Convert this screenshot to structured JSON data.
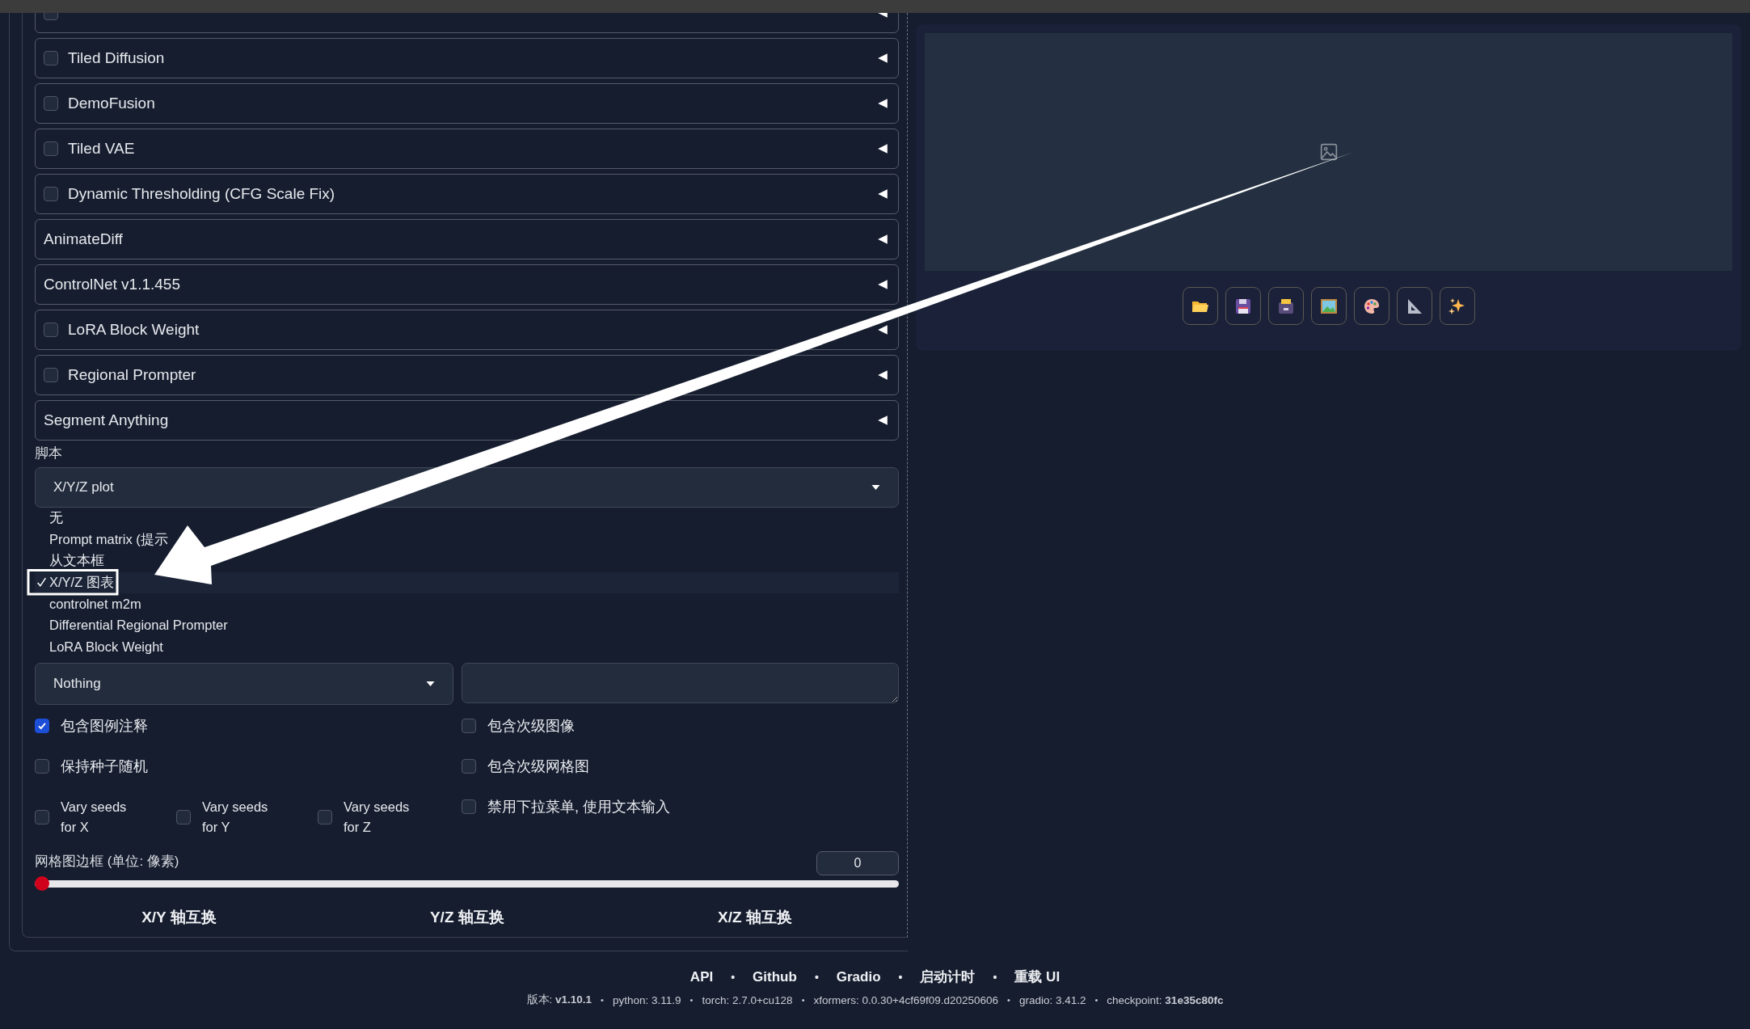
{
  "accordions": [
    {
      "kind": "checkbox",
      "checked": false
    },
    {
      "label": "Tiled Diffusion",
      "kind": "checkbox",
      "checked": false
    },
    {
      "label": "DemoFusion",
      "kind": "checkbox",
      "checked": false
    },
    {
      "label": "Tiled VAE",
      "kind": "checkbox",
      "checked": false
    },
    {
      "label": "Dynamic Thresholding (CFG Scale Fix)",
      "kind": "checkbox",
      "checked": false
    },
    {
      "label": "AnimateDiff",
      "kind": "plain"
    },
    {
      "label": "ControlNet v1.1.455",
      "kind": "plain"
    },
    {
      "label": "LoRA Block Weight",
      "kind": "checkbox",
      "checked": false
    },
    {
      "label": "Regional Prompter",
      "kind": "checkbox",
      "checked": false
    },
    {
      "label": "Segment Anything",
      "kind": "plain"
    }
  ],
  "script": {
    "label": "脚本",
    "value": "X/Y/Z plot",
    "options": [
      {
        "label": "无",
        "selected": false
      },
      {
        "label": "Prompt matrix (提示",
        "selected": false
      },
      {
        "label": "从文本框",
        "selected": false
      },
      {
        "label": "X/Y/Z 图表",
        "selected": true
      },
      {
        "label": "controlnet m2m",
        "selected": false
      },
      {
        "label": "Differential Regional Prompter",
        "selected": false
      },
      {
        "label": "LoRA Block Weight",
        "selected": false
      }
    ]
  },
  "axis_type": "Nothing",
  "options_left": [
    {
      "label": "包含图例注释",
      "checked": true
    },
    {
      "label": "保持种子随机",
      "checked": false
    }
  ],
  "vary_seeds": [
    {
      "label": "Vary seeds for X",
      "checked": false
    },
    {
      "label": "Vary seeds for Y",
      "checked": false
    },
    {
      "label": "Vary seeds for Z",
      "checked": false
    }
  ],
  "options_right": [
    {
      "label": "包含次级图像",
      "checked": false
    },
    {
      "label": "包含次级网格图",
      "checked": false
    },
    {
      "label": "禁用下拉菜单, 使用文本输入",
      "checked": false
    }
  ],
  "slider": {
    "label": "网格图边框 (单位: 像素)",
    "value": "0",
    "level": 0
  },
  "swap_buttons": [
    "X/Y 轴互换",
    "Y/Z 轴互换",
    "X/Z 轴互换"
  ],
  "tool_buttons": [
    {
      "kind": "folder"
    },
    {
      "kind": "save"
    },
    {
      "kind": "archive"
    },
    {
      "kind": "picture"
    },
    {
      "kind": "palette"
    },
    {
      "kind": "ruler"
    },
    {
      "kind": "sparkles"
    }
  ],
  "footer": {
    "separator": "•",
    "links": [
      "API",
      "Github",
      "Gradio",
      "启动计时",
      "重载 UI"
    ],
    "versions": [
      "版本: **v1.10.1**",
      "python: 3.11.9",
      "torch: 2.7.0+cu128",
      "xformers: 0.0.30+4cf69f09.d20250606",
      "gradio: 3.41.2",
      "checkpoint: **31e35c80fc**"
    ]
  }
}
